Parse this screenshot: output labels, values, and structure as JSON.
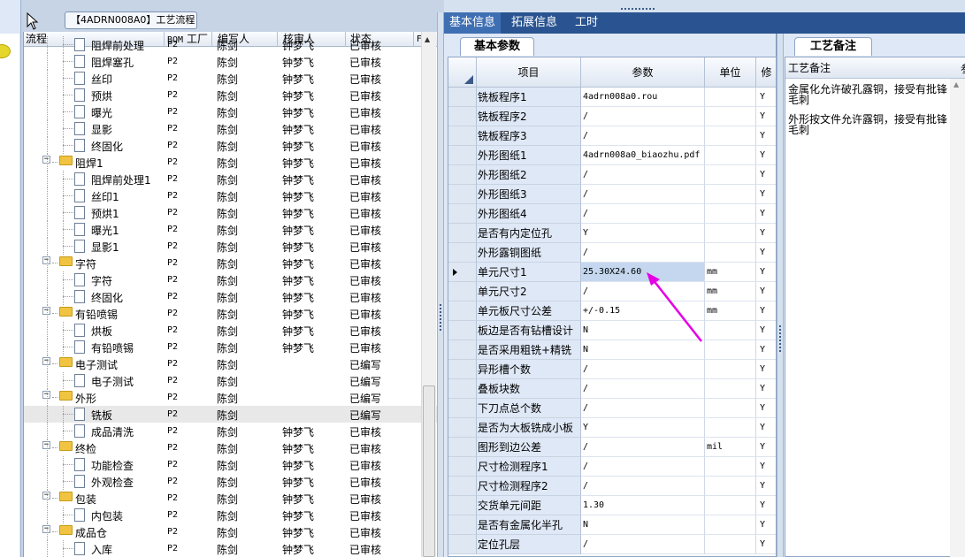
{
  "tooltip": "【4ADRN008A0】工艺流程",
  "tree": {
    "headers": {
      "flow": "流程",
      "bom": "BOM",
      "factory": "工厂",
      "author": "编写人",
      "reviewer": "核审人",
      "status": "状态",
      "extra": "F"
    },
    "rows": [
      {
        "name": "阻焊前处理",
        "level": 2,
        "type": "doc",
        "bom": "P2",
        "author": "陈剑",
        "reviewer": "钟梦飞",
        "status": "已审核"
      },
      {
        "name": "阻焊塞孔",
        "level": 2,
        "type": "doc",
        "bom": "P2",
        "author": "陈剑",
        "reviewer": "钟梦飞",
        "status": "已审核"
      },
      {
        "name": "丝印",
        "level": 2,
        "type": "doc",
        "bom": "P2",
        "author": "陈剑",
        "reviewer": "钟梦飞",
        "status": "已审核"
      },
      {
        "name": "预烘",
        "level": 2,
        "type": "doc",
        "bom": "P2",
        "author": "陈剑",
        "reviewer": "钟梦飞",
        "status": "已审核"
      },
      {
        "name": "曝光",
        "level": 2,
        "type": "doc",
        "bom": "P2",
        "author": "陈剑",
        "reviewer": "钟梦飞",
        "status": "已审核"
      },
      {
        "name": "显影",
        "level": 2,
        "type": "doc",
        "bom": "P2",
        "author": "陈剑",
        "reviewer": "钟梦飞",
        "status": "已审核"
      },
      {
        "name": "终固化",
        "level": 2,
        "type": "doc",
        "bom": "P2",
        "author": "陈剑",
        "reviewer": "钟梦飞",
        "status": "已审核"
      },
      {
        "name": "阻焊1",
        "level": 1,
        "type": "folder",
        "bom": "P2",
        "author": "陈剑",
        "reviewer": "钟梦飞",
        "status": "已审核"
      },
      {
        "name": "阻焊前处理1",
        "level": 2,
        "type": "doc",
        "bom": "P2",
        "author": "陈剑",
        "reviewer": "钟梦飞",
        "status": "已审核"
      },
      {
        "name": "丝印1",
        "level": 2,
        "type": "doc",
        "bom": "P2",
        "author": "陈剑",
        "reviewer": "钟梦飞",
        "status": "已审核"
      },
      {
        "name": "预烘1",
        "level": 2,
        "type": "doc",
        "bom": "P2",
        "author": "陈剑",
        "reviewer": "钟梦飞",
        "status": "已审核"
      },
      {
        "name": "曝光1",
        "level": 2,
        "type": "doc",
        "bom": "P2",
        "author": "陈剑",
        "reviewer": "钟梦飞",
        "status": "已审核"
      },
      {
        "name": "显影1",
        "level": 2,
        "type": "doc",
        "bom": "P2",
        "author": "陈剑",
        "reviewer": "钟梦飞",
        "status": "已审核"
      },
      {
        "name": "字符",
        "level": 1,
        "type": "folder",
        "bom": "P2",
        "author": "陈剑",
        "reviewer": "钟梦飞",
        "status": "已审核"
      },
      {
        "name": "字符",
        "level": 2,
        "type": "doc",
        "bom": "P2",
        "author": "陈剑",
        "reviewer": "钟梦飞",
        "status": "已审核"
      },
      {
        "name": "终固化",
        "level": 2,
        "type": "doc",
        "bom": "P2",
        "author": "陈剑",
        "reviewer": "钟梦飞",
        "status": "已审核"
      },
      {
        "name": "有铅喷锡",
        "level": 1,
        "type": "folder",
        "bom": "P2",
        "author": "陈剑",
        "reviewer": "钟梦飞",
        "status": "已审核"
      },
      {
        "name": "烘板",
        "level": 2,
        "type": "doc",
        "bom": "P2",
        "author": "陈剑",
        "reviewer": "钟梦飞",
        "status": "已审核"
      },
      {
        "name": "有铅喷锡",
        "level": 2,
        "type": "doc",
        "bom": "P2",
        "author": "陈剑",
        "reviewer": "钟梦飞",
        "status": "已审核"
      },
      {
        "name": "电子测试",
        "level": 1,
        "type": "folder",
        "bom": "P2",
        "author": "陈剑",
        "reviewer": "",
        "status": "已编写"
      },
      {
        "name": "电子测试",
        "level": 2,
        "type": "doc",
        "bom": "P2",
        "author": "陈剑",
        "reviewer": "",
        "status": "已编写"
      },
      {
        "name": "外形",
        "level": 1,
        "type": "folder",
        "bom": "P2",
        "author": "陈剑",
        "reviewer": "",
        "status": "已编写"
      },
      {
        "name": "铣板",
        "level": 2,
        "type": "doc",
        "bom": "P2",
        "author": "陈剑",
        "reviewer": "",
        "status": "已编写",
        "selected": true
      },
      {
        "name": "成品清洗",
        "level": 2,
        "type": "doc",
        "bom": "P2",
        "author": "陈剑",
        "reviewer": "钟梦飞",
        "status": "已审核"
      },
      {
        "name": "终检",
        "level": 1,
        "type": "folder",
        "bom": "P2",
        "author": "陈剑",
        "reviewer": "钟梦飞",
        "status": "已审核"
      },
      {
        "name": "功能检查",
        "level": 2,
        "type": "doc",
        "bom": "P2",
        "author": "陈剑",
        "reviewer": "钟梦飞",
        "status": "已审核"
      },
      {
        "name": "外观检查",
        "level": 2,
        "type": "doc",
        "bom": "P2",
        "author": "陈剑",
        "reviewer": "钟梦飞",
        "status": "已审核"
      },
      {
        "name": "包装",
        "level": 1,
        "type": "folder",
        "bom": "P2",
        "author": "陈剑",
        "reviewer": "钟梦飞",
        "status": "已审核"
      },
      {
        "name": "内包装",
        "level": 2,
        "type": "doc",
        "bom": "P2",
        "author": "陈剑",
        "reviewer": "钟梦飞",
        "status": "已审核"
      },
      {
        "name": "成品仓",
        "level": 1,
        "type": "folder",
        "bom": "P2",
        "author": "陈剑",
        "reviewer": "钟梦飞",
        "status": "已审核"
      },
      {
        "name": "入库",
        "level": 2,
        "type": "doc",
        "bom": "P2",
        "author": "陈剑",
        "reviewer": "钟梦飞",
        "status": "已审核"
      }
    ]
  },
  "tabs": [
    "基本信息",
    "拓展信息",
    "工时"
  ],
  "info": {
    "subtab": "基本参数",
    "headers": {
      "item": "项目",
      "param": "参数",
      "unit": "单位",
      "flag": "修"
    },
    "rows": [
      {
        "name": "铣板程序1",
        "param": "4adrn008a0.rou",
        "unit": "",
        "flag": "Y"
      },
      {
        "name": "铣板程序2",
        "param": "/",
        "unit": "",
        "flag": "Y"
      },
      {
        "name": "铣板程序3",
        "param": "/",
        "unit": "",
        "flag": "Y"
      },
      {
        "name": "外形图纸1",
        "param": "4adrn008a0_biaozhu.pdf",
        "unit": "",
        "flag": "Y"
      },
      {
        "name": "外形图纸2",
        "param": "/",
        "unit": "",
        "flag": "Y"
      },
      {
        "name": "外形图纸3",
        "param": "/",
        "unit": "",
        "flag": "Y"
      },
      {
        "name": "外形图纸4",
        "param": "/",
        "unit": "",
        "flag": "Y"
      },
      {
        "name": "是否有内定位孔",
        "param": "Y",
        "unit": "",
        "flag": "Y"
      },
      {
        "name": "外形露铜图纸",
        "param": "/",
        "unit": "",
        "flag": "Y"
      },
      {
        "name": "单元尺寸1",
        "param": "25.30X24.60",
        "unit": "mm",
        "flag": "Y",
        "current": true
      },
      {
        "name": "单元尺寸2",
        "param": "/",
        "unit": "mm",
        "flag": "Y"
      },
      {
        "name": "单元板尺寸公差",
        "param": "+/-0.15",
        "unit": "mm",
        "flag": "Y"
      },
      {
        "name": "板边是否有钻槽设计",
        "param": "N",
        "unit": "",
        "flag": "Y"
      },
      {
        "name": "是否采用粗铣+精铣",
        "param": "N",
        "unit": "",
        "flag": "Y"
      },
      {
        "name": "异形槽个数",
        "param": "/",
        "unit": "",
        "flag": "Y"
      },
      {
        "name": "叠板块数",
        "param": "/",
        "unit": "",
        "flag": "Y"
      },
      {
        "name": "下刀点总个数",
        "param": "/",
        "unit": "",
        "flag": "Y"
      },
      {
        "name": "是否为大板铣成小板",
        "param": "Y",
        "unit": "",
        "flag": "Y"
      },
      {
        "name": "图形到边公差",
        "param": "/",
        "unit": "mil",
        "flag": "Y"
      },
      {
        "name": "尺寸检测程序1",
        "param": "/",
        "unit": "",
        "flag": "Y"
      },
      {
        "name": "尺寸检测程序2",
        "param": "/",
        "unit": "",
        "flag": "Y"
      },
      {
        "name": "交货单元间距",
        "param": "1.30",
        "unit": "",
        "flag": "Y"
      },
      {
        "name": "是否有金属化半孔",
        "param": "N",
        "unit": "",
        "flag": "Y"
      },
      {
        "name": "定位孔层",
        "param": "/",
        "unit": "",
        "flag": "Y"
      }
    ]
  },
  "notes": {
    "subtab": "工艺备注",
    "header": "工艺备注",
    "extra_header": "参",
    "lines": [
      "金属化允许破孔露铜，接受有批锋毛刺",
      "外形按文件允许露铜，接受有批锋毛刺"
    ]
  },
  "colors": {
    "tab_bar": "#2a5491",
    "annotation_arrow": "#e600e6",
    "folder": "#f0c440"
  }
}
